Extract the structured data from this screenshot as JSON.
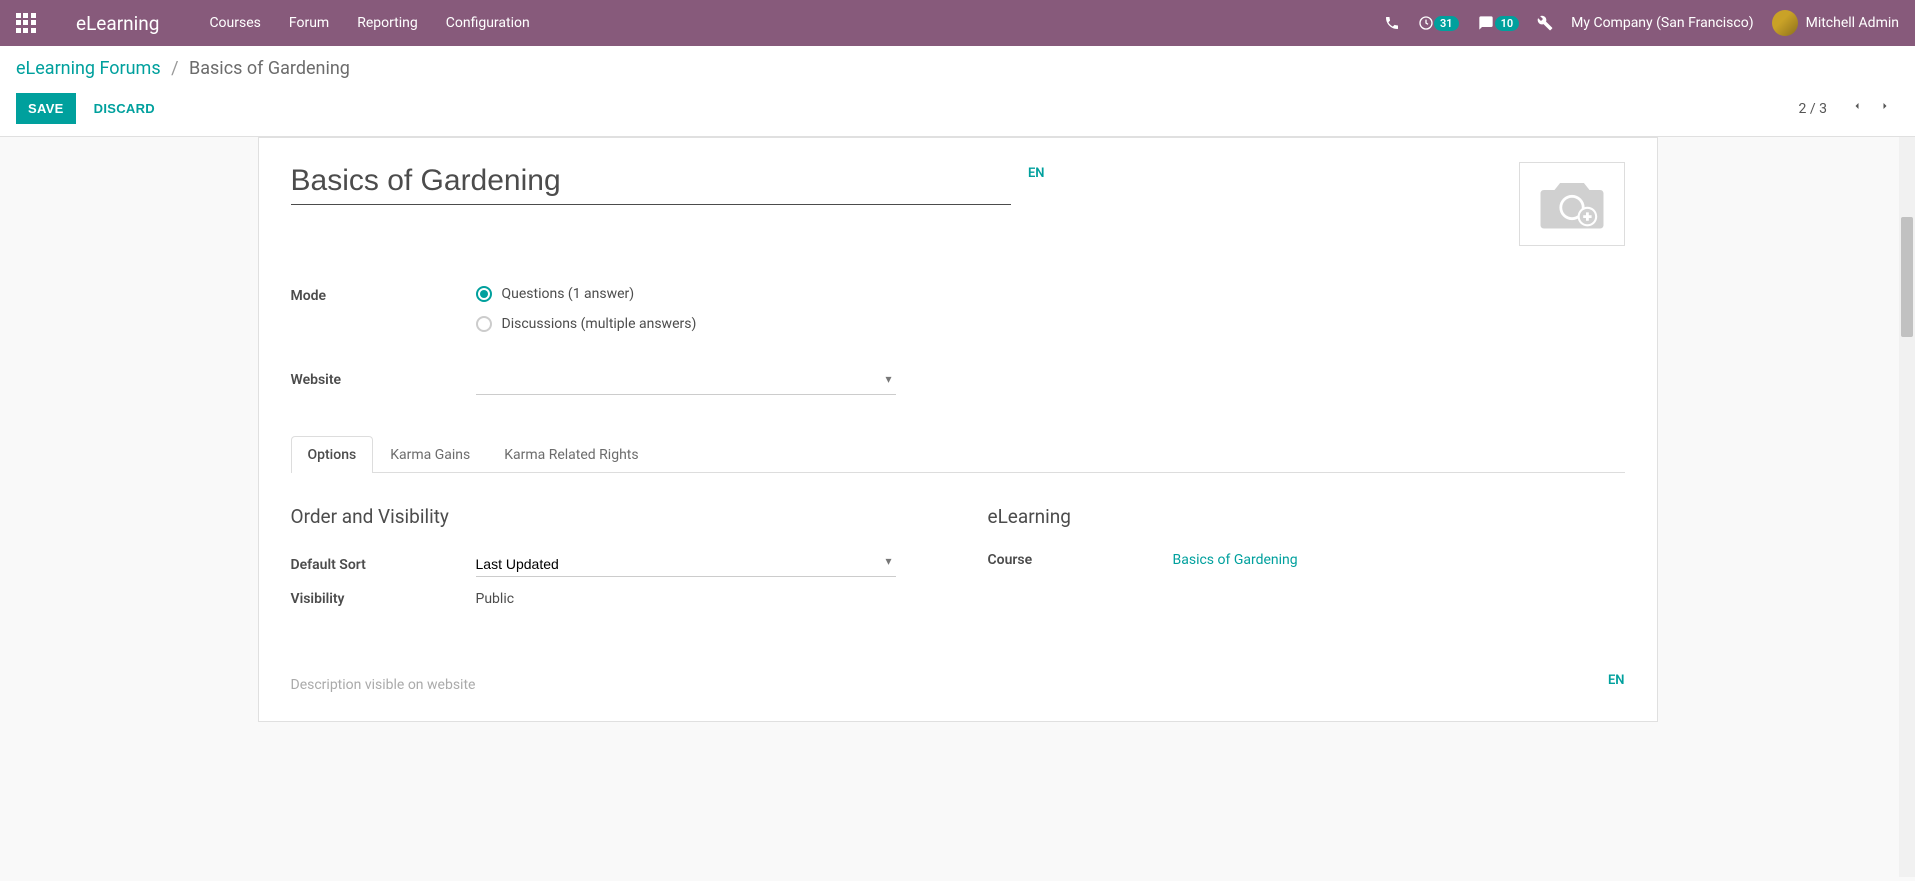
{
  "header": {
    "app_name": "eLearning",
    "nav": [
      "Courses",
      "Forum",
      "Reporting",
      "Configuration"
    ],
    "badge_activities": "31",
    "badge_messages": "10",
    "company": "My Company (San Francisco)",
    "user": "Mitchell Admin"
  },
  "breadcrumb": {
    "parent": "eLearning Forums",
    "separator": "/",
    "current": "Basics of Gardening"
  },
  "buttons": {
    "save": "SAVE",
    "discard": "DISCARD"
  },
  "pager": {
    "text": "2 / 3"
  },
  "form": {
    "title": "Basics of Gardening",
    "title_lang": "EN",
    "labels": {
      "mode": "Mode",
      "website": "Website"
    },
    "mode_options": {
      "questions": "Questions (1 answer)",
      "discussions": "Discussions (multiple answers)"
    },
    "website_value": ""
  },
  "tabs": {
    "options": "Options",
    "karma_gains": "Karma Gains",
    "karma_rights": "Karma Related Rights"
  },
  "options_tab": {
    "left": {
      "heading": "Order and Visibility",
      "default_sort_label": "Default Sort",
      "default_sort_value": "Last Updated",
      "visibility_label": "Visibility",
      "visibility_value": "Public"
    },
    "right": {
      "heading": "eLearning",
      "course_label": "Course",
      "course_value": "Basics of Gardening"
    },
    "description_placeholder": "Description visible on website",
    "description_lang": "EN"
  }
}
